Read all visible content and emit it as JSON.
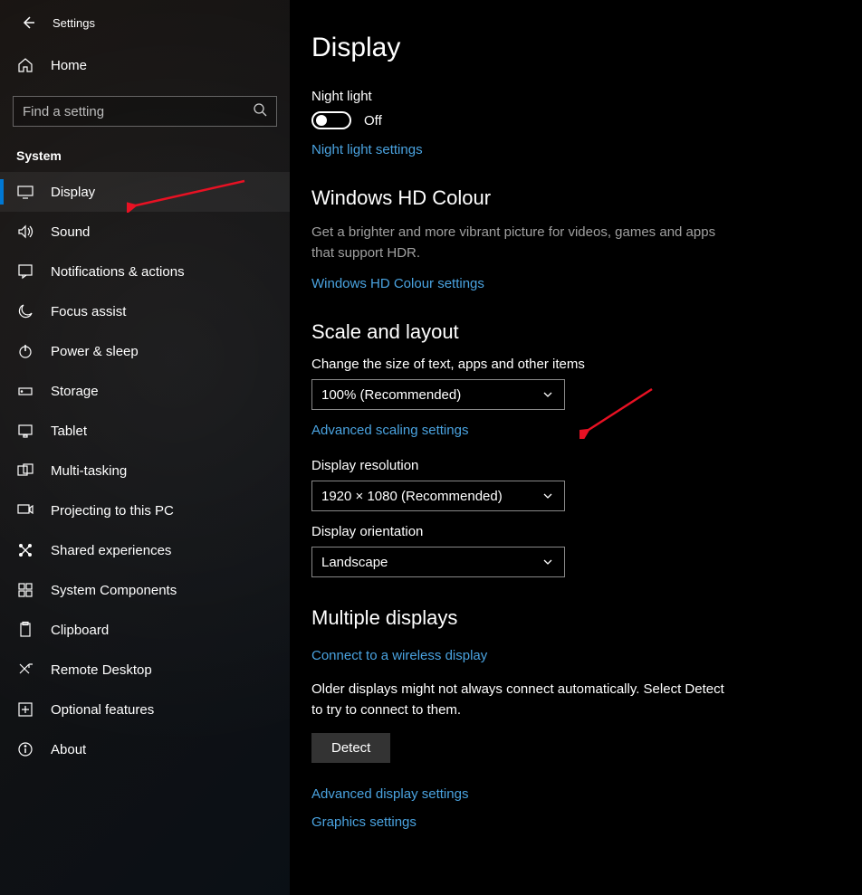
{
  "header": {
    "title": "Settings"
  },
  "search": {
    "placeholder": "Find a setting"
  },
  "home": {
    "label": "Home"
  },
  "sidebar": {
    "section": "System",
    "items": [
      {
        "label": "Display"
      },
      {
        "label": "Sound"
      },
      {
        "label": "Notifications & actions"
      },
      {
        "label": "Focus assist"
      },
      {
        "label": "Power & sleep"
      },
      {
        "label": "Storage"
      },
      {
        "label": "Tablet"
      },
      {
        "label": "Multi-tasking"
      },
      {
        "label": "Projecting to this PC"
      },
      {
        "label": "Shared experiences"
      },
      {
        "label": "System Components"
      },
      {
        "label": "Clipboard"
      },
      {
        "label": "Remote Desktop"
      },
      {
        "label": "Optional features"
      },
      {
        "label": "About"
      }
    ]
  },
  "page": {
    "title": "Display",
    "night_light": {
      "label": "Night light",
      "state": "Off",
      "link": "Night light settings"
    },
    "hd": {
      "title": "Windows HD Colour",
      "desc": "Get a brighter and more vibrant picture for videos, games and apps that support HDR.",
      "link": "Windows HD Colour settings"
    },
    "scale": {
      "title": "Scale and layout",
      "size_label": "Change the size of text, apps and other items",
      "size_value": "100% (Recommended)",
      "adv_scaling": "Advanced scaling settings",
      "resolution_label": "Display resolution",
      "resolution_value": "1920 × 1080 (Recommended)",
      "orientation_label": "Display orientation",
      "orientation_value": "Landscape"
    },
    "multi": {
      "title": "Multiple displays",
      "connect": "Connect to a wireless display",
      "desc": "Older displays might not always connect automatically. Select Detect to try to connect to them.",
      "detect": "Detect",
      "adv": "Advanced display settings",
      "graphics": "Graphics settings"
    }
  }
}
